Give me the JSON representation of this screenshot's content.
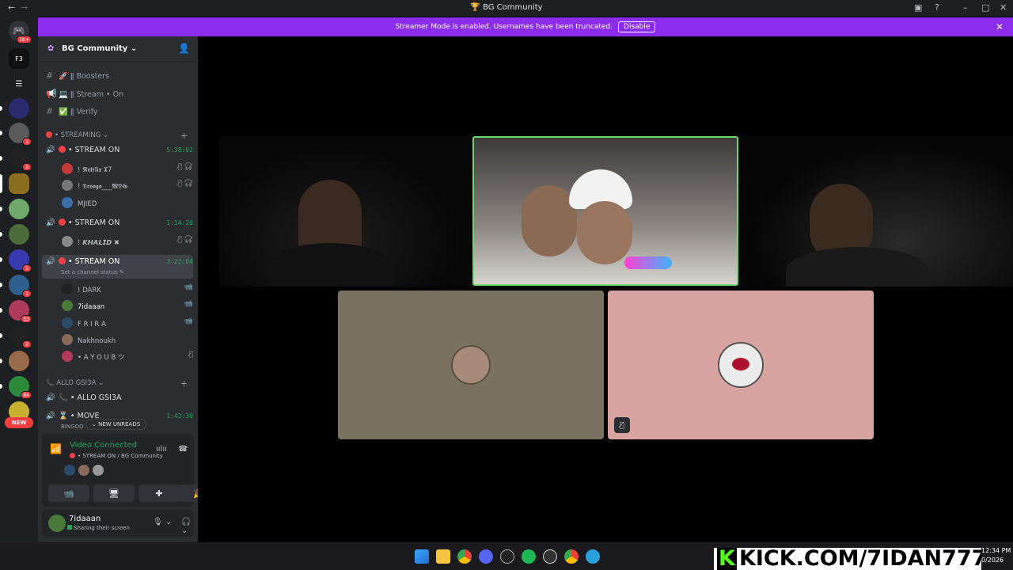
{
  "window": {
    "title": "BG Community",
    "controls": [
      "–",
      "□",
      "✕"
    ]
  },
  "banner": {
    "text": "Streamer Mode is enabled. Usernames have been truncated.",
    "button": "Disable"
  },
  "rail": {
    "badges": [
      "1K+",
      "1",
      "2",
      "1",
      "1",
      "53",
      "2",
      "84",
      "NEW"
    ],
    "top_label": "F3"
  },
  "server": {
    "name": "BG Community",
    "channels": [
      {
        "icon": "hash-icon",
        "emoji": "🚀",
        "label": "ǁ Boosters"
      },
      {
        "icon": "announce-icon",
        "emoji": "💻",
        "label": "ǁ Stream • On"
      },
      {
        "icon": "hash-icon",
        "emoji": "✅",
        "label": "ǁ Verify"
      }
    ],
    "category_streaming": "• STREAMING",
    "voice_channels": [
      {
        "label": "• STREAM ON",
        "time": "5:38:02",
        "users": [
          "! 𝕹𝖊𝖙𝖋𝖑𝖎𝖝 𝖃7",
          "! 𝕯𝖗𝖔𝖔𝖌𝖔___𝕸𝕯𝕲",
          "MJIED"
        ]
      },
      {
        "label": "• STREAM ON",
        "time": "1:14:20",
        "users": [
          "! 𝙆𝙃𝘼𝙇𝙄𝘿 ✖"
        ]
      },
      {
        "label": "• STREAM ON",
        "time": "3:22:04",
        "status": "Set a channel status",
        "users": [
          "! DARK",
          "7idaaan",
          "F R I R A",
          "Nakhnoukh",
          "• A Y O U B ツ"
        ]
      }
    ],
    "category_allo": "ALLO GSI3A",
    "allo_channels": [
      {
        "label": "• ALLO GSI3A",
        "time": ""
      },
      {
        "label": "• MOVE",
        "time": "1:42:30",
        "sub": "BINGOO"
      }
    ],
    "new_unreads": "NEW UNREADS"
  },
  "voice_panel": {
    "status": "Video Connected",
    "channel": "• STREAM ON / BG Community"
  },
  "user_panel": {
    "name": "7idaaan",
    "status": "Sharing their screen"
  },
  "overlay": {
    "kick_text": "KICK.COM/7IDAN777",
    "clock_time": "12:34 PM",
    "clock_date": "0/2026"
  },
  "colors": {
    "accent": "#8c2ded",
    "voice_green": "#23a55a",
    "speaking_border": "#6dd66d",
    "tile_pink": "#d8a4a2",
    "tile_khaki": "#7a7160"
  }
}
